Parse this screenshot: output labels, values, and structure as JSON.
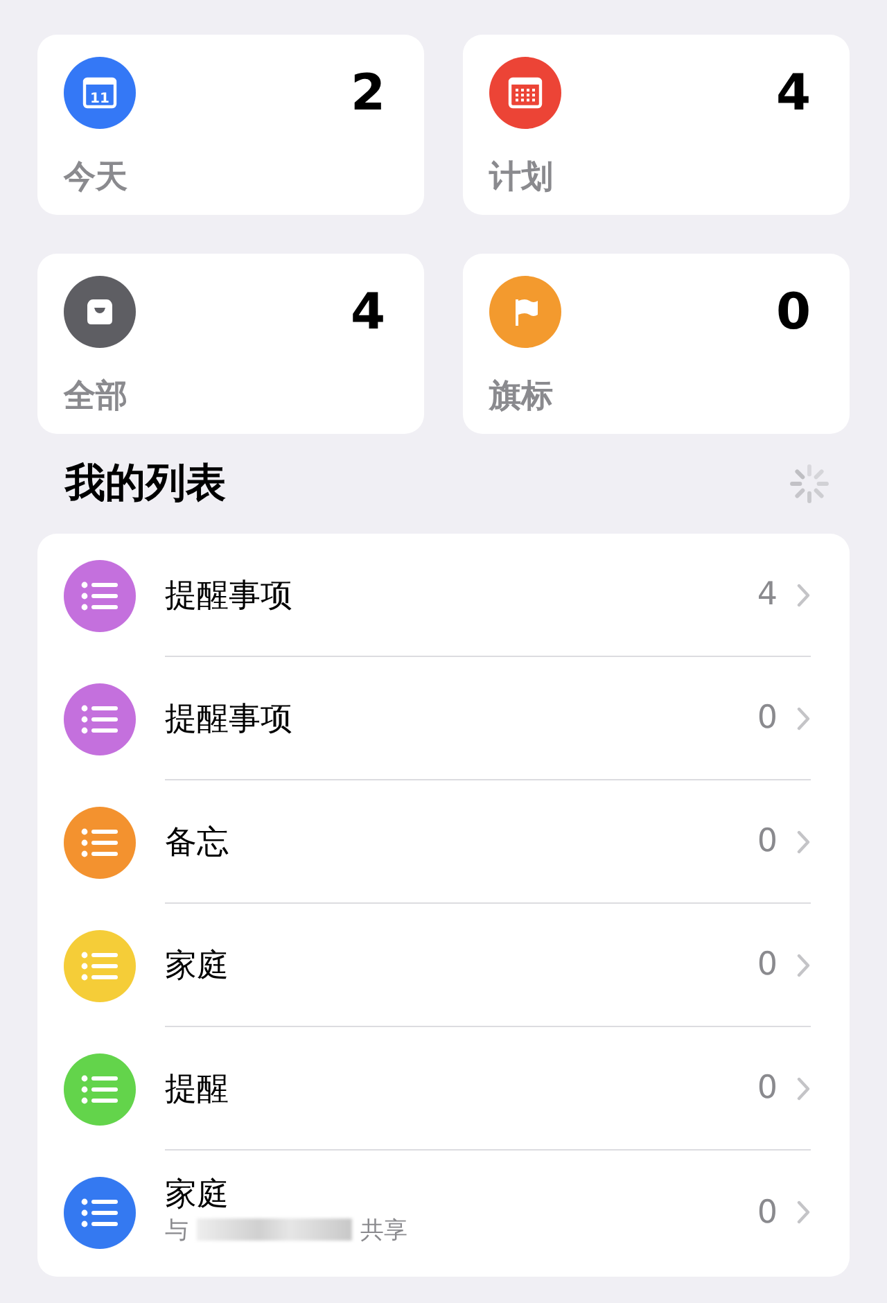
{
  "smart_lists": [
    {
      "kind": "today",
      "label": "今天",
      "count": "2",
      "color": "#3478f6",
      "day": "11"
    },
    {
      "kind": "scheduled",
      "label": "计划",
      "count": "4",
      "color": "#ec4436"
    },
    {
      "kind": "all",
      "label": "全部",
      "count": "4",
      "color": "#5e5e63"
    },
    {
      "kind": "flagged",
      "label": "旗标",
      "count": "0",
      "color": "#f39a2e"
    }
  ],
  "my_lists": {
    "title": "我的列表",
    "loading": true,
    "items": [
      {
        "name": "提醒事项",
        "count": "4",
        "color": "#c470dd"
      },
      {
        "name": "提醒事项",
        "count": "0",
        "color": "#c470dd"
      },
      {
        "name": "备忘",
        "count": "0",
        "color": "#f3922f"
      },
      {
        "name": "家庭",
        "count": "0",
        "color": "#f5cd38"
      },
      {
        "name": "提醒",
        "count": "0",
        "color": "#63d44b"
      },
      {
        "name": "家庭",
        "count": "0",
        "color": "#3479f1",
        "shared_prefix": "与",
        "shared_suffix": "共享"
      }
    ]
  }
}
